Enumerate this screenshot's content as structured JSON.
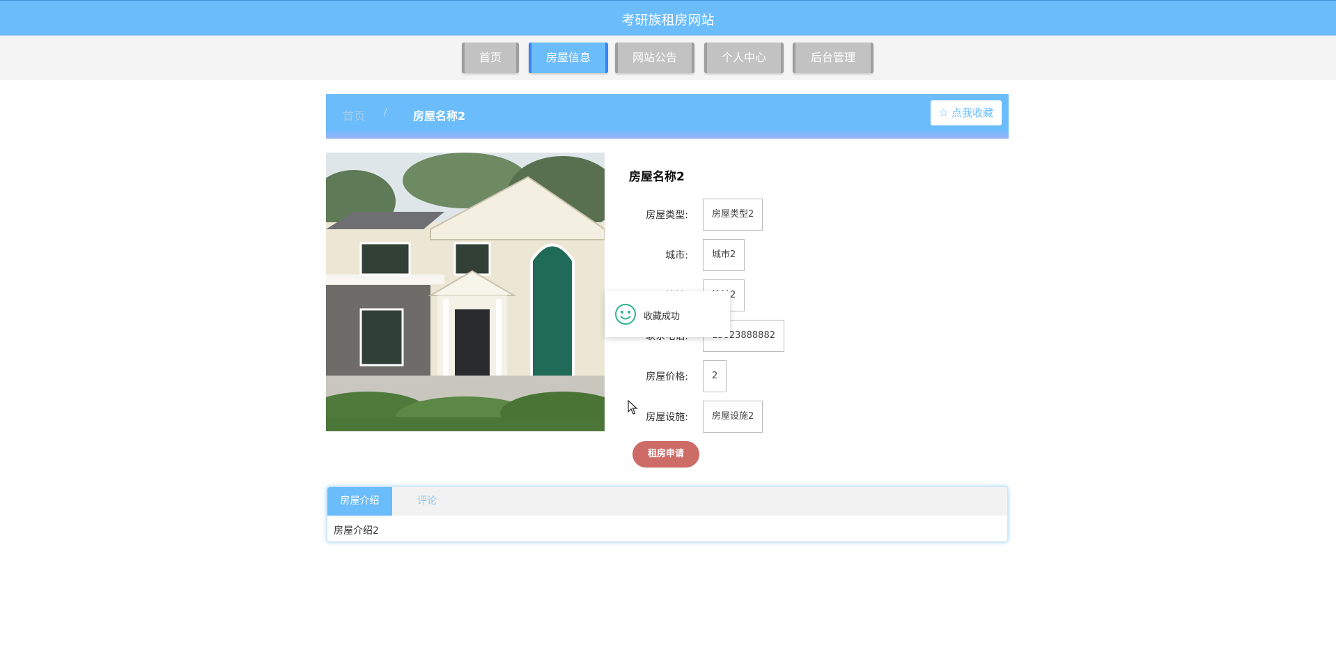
{
  "header": {
    "site_title": "考研族租房网站"
  },
  "nav": {
    "items": [
      {
        "label": "首页",
        "active": false
      },
      {
        "label": "房屋信息",
        "active": true
      },
      {
        "label": "网站公告",
        "active": false
      },
      {
        "label": "个人中心",
        "active": false
      },
      {
        "label": "后台管理",
        "active": false
      }
    ]
  },
  "breadcrumb": {
    "home": "首页",
    "separator": "/",
    "current": "房屋名称2"
  },
  "favorite_button": {
    "label": "点我收藏",
    "icon": "star-outline-icon"
  },
  "house": {
    "title": "房屋名称2",
    "fields": [
      {
        "label": "房屋类型:",
        "value": "房屋类型2"
      },
      {
        "label": "城市:",
        "value": "城市2"
      },
      {
        "label": "地址:",
        "value": "地址2"
      },
      {
        "label": "联系电话:",
        "value": "13823888882"
      },
      {
        "label": "房屋价格:",
        "value": "2"
      },
      {
        "label": "房屋设施:",
        "value": "房屋设施2"
      }
    ]
  },
  "apply_button": {
    "label": "租房申请"
  },
  "toast": {
    "message": "收藏成功",
    "icon": "smile-icon"
  },
  "tabs": {
    "items": [
      {
        "label": "房屋介绍",
        "active": true
      },
      {
        "label": "评论",
        "active": false
      }
    ],
    "content": "房屋介绍2"
  },
  "colors": {
    "primary": "#6bbcfb",
    "apply": "#cd6b67",
    "nav_inactive": "#c2c2c2",
    "toast_icon": "#2fb38a"
  }
}
